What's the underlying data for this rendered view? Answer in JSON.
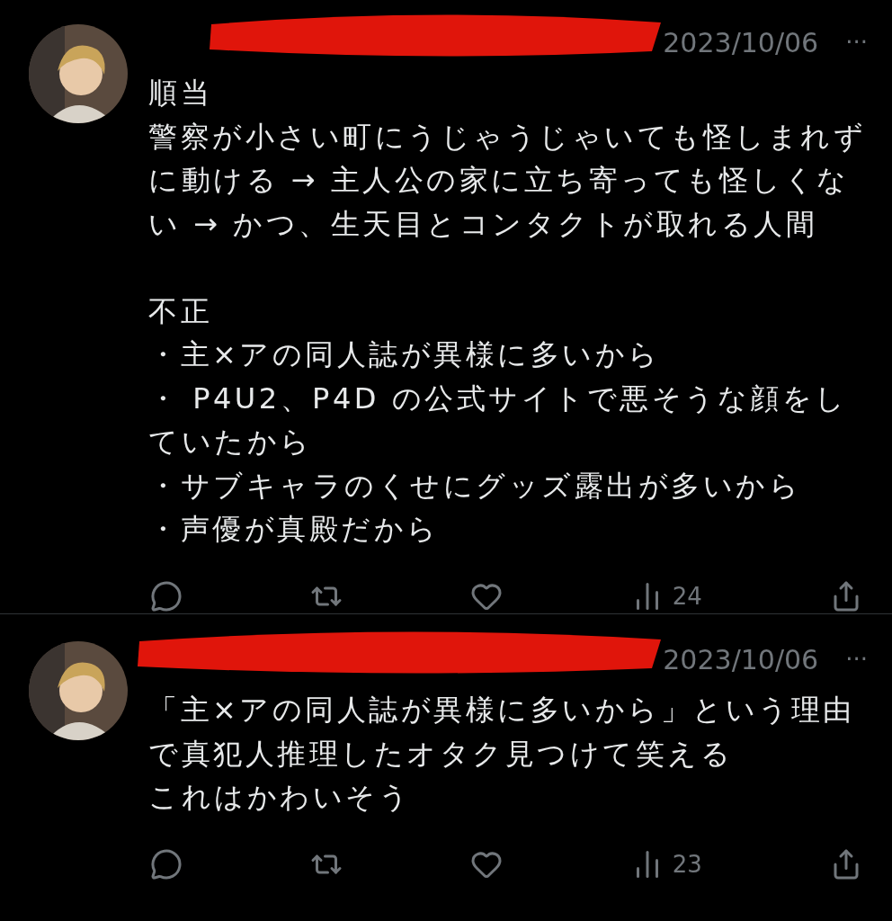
{
  "tweets": [
    {
      "date": "2023/10/06",
      "more": "···",
      "paragraphs": [
        [
          "順当",
          "警察が小さい町にうじゃうじゃいても怪しまれずに動ける → 主人公の家に立ち寄っても怪しくない → かつ、生天目とコンタクトが取れる人間"
        ],
        [
          "不正",
          "・主×アの同人誌が異様に多いから",
          "・ P4U2、P4D の公式サイトで悪そうな顔をしていたから",
          "・サブキャラのくせにグッズ露出が多いから",
          "・声優が真殿だから"
        ]
      ],
      "actions": [
        {
          "kind": "reply"
        },
        {
          "kind": "repost"
        },
        {
          "kind": "like"
        },
        {
          "kind": "views",
          "count": "24"
        },
        {
          "kind": "share"
        }
      ]
    },
    {
      "date": "2023/10/06",
      "more": "···",
      "paragraphs": [
        [
          "「主×アの同人誌が異様に多いから」という理由で真犯人推理したオタク見つけて笑える",
          "これはかわいそう"
        ]
      ],
      "actions": [
        {
          "kind": "reply"
        },
        {
          "kind": "repost"
        },
        {
          "kind": "like"
        },
        {
          "kind": "views",
          "count": "23"
        },
        {
          "kind": "share"
        }
      ]
    }
  ]
}
